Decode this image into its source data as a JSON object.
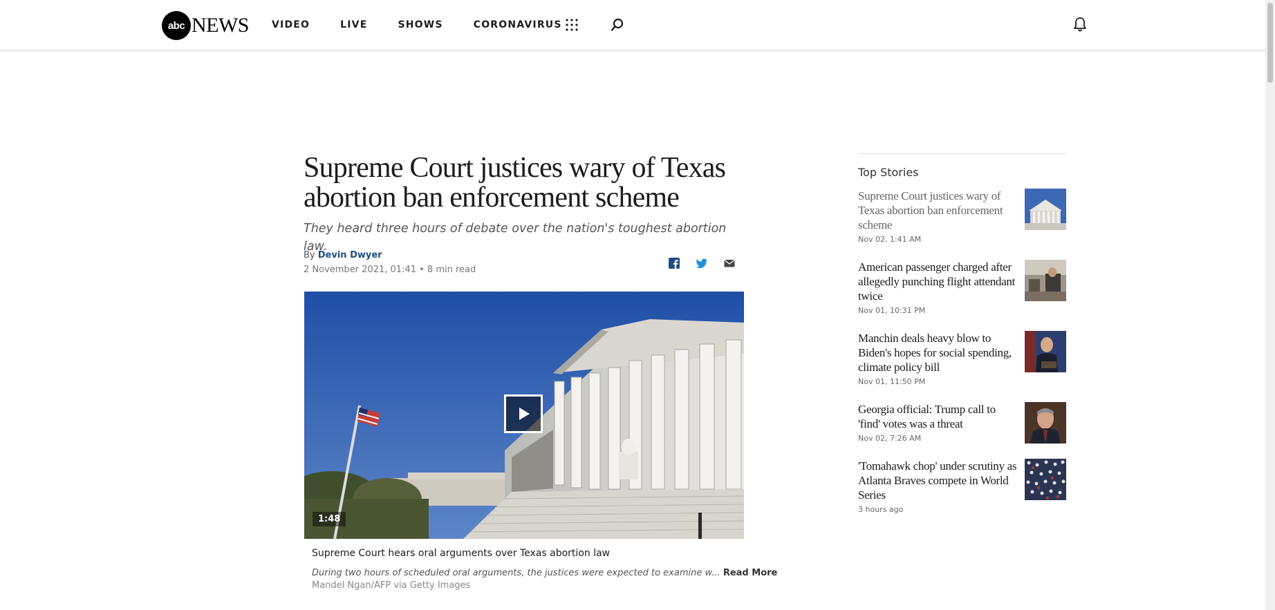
{
  "header": {
    "logo_abc": "abc",
    "logo_news": "NEWS",
    "nav": [
      "VIDEO",
      "LIVE",
      "SHOWS",
      "CORONAVIRUS"
    ]
  },
  "article": {
    "headline": "Supreme Court justices wary of Texas abortion ban enforcement scheme",
    "subheadline": "They heard three hours of debate over the nation's toughest abortion law.",
    "by_prefix": "By",
    "author": "Devin Dwyer",
    "date": "2 November 2021, 01:41",
    "read_time": "• 8 min read",
    "video": {
      "duration": "1:48",
      "caption_title": "Supreme Court hears oral arguments over Texas abortion law",
      "caption_desc": "During two hours of scheduled oral arguments, the justices were expected to examine w...",
      "read_more": "Read More",
      "credit": "Mandel Ngan/AFP via Getty Images"
    }
  },
  "sidebar": {
    "title": "Top Stories",
    "stories": [
      {
        "headline": "Supreme Court justices wary of Texas abortion ban enforcement scheme",
        "time": "Nov 02, 1:41 AM"
      },
      {
        "headline": "American passenger charged after allegedly punching flight attendant twice",
        "time": "Nov 01, 10:31 PM"
      },
      {
        "headline": "Manchin deals heavy blow to Biden's hopes for social spending, climate policy bill",
        "time": "Nov 01, 11:50 PM"
      },
      {
        "headline": "Georgia official: Trump call to 'find' votes was a threat",
        "time": "Nov 02, 7:26 AM"
      },
      {
        "headline": "'Tomahawk chop' under scrutiny as Atlanta Braves compete in World Series",
        "time": "3 hours ago"
      }
    ]
  },
  "icons": {
    "menu": "grid-icon",
    "search": "search-icon",
    "notifications": "bell-icon",
    "share": [
      "facebook-icon",
      "twitter-icon",
      "email-icon"
    ],
    "play": "play-icon"
  },
  "colors": {
    "author_link": "#1d4d87",
    "text": "#1c1c1c"
  }
}
